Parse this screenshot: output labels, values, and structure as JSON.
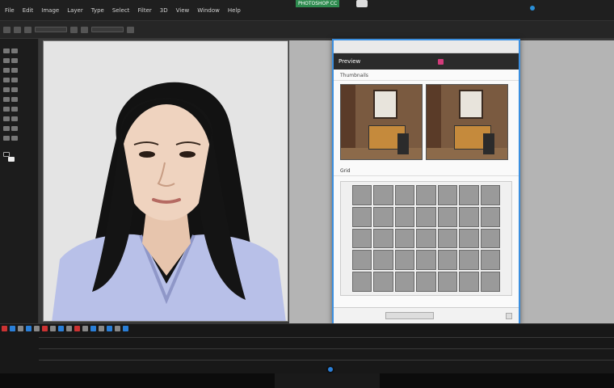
{
  "app": {
    "window_chip": "PHOTOSHOP CC"
  },
  "menubar": {
    "items": [
      "File",
      "Edit",
      "Image",
      "Layer",
      "Type",
      "Select",
      "Filter",
      "3D",
      "View",
      "Window",
      "Help"
    ]
  },
  "dialog": {
    "title": "",
    "bar_title": "Preview",
    "section1_label": "Thumbnails",
    "section2_label": "Grid",
    "grid": {
      "rows": 5,
      "cols": 7
    },
    "footer_text": ""
  },
  "colors": {
    "accent": "#3b8fe0",
    "chip_green": "#2e8b4f",
    "badge": "#d33b7a"
  },
  "icons": [
    "shield-icon",
    "search-icon",
    "gear-icon"
  ]
}
